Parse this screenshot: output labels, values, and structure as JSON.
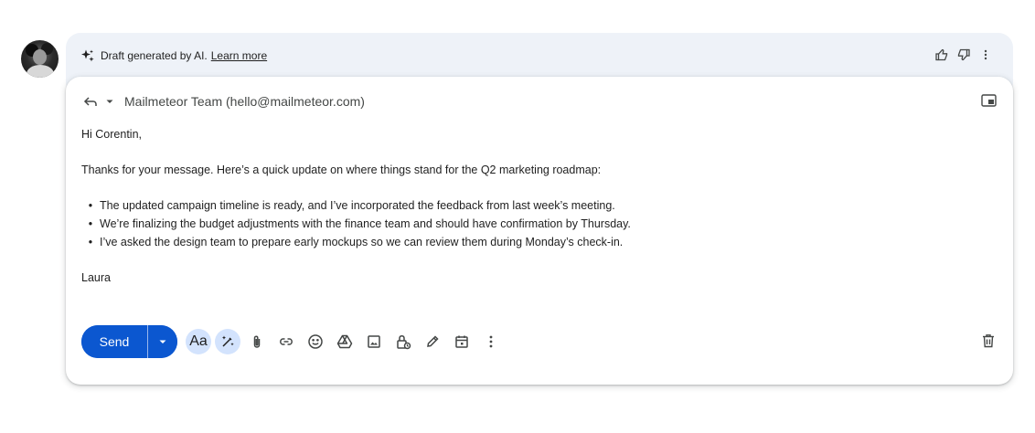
{
  "ai_banner": {
    "text": "Draft generated by AI.",
    "link": "Learn more",
    "icons": [
      "sparkle-icon",
      "thumbs-up-icon",
      "thumbs-down-icon",
      "more-vert-icon"
    ]
  },
  "compose": {
    "from": "Mailmeteor Team (hello@mailmeteor.com)",
    "greeting": "Hi Corentin,",
    "intro": "Thanks for your message. Here’s a quick update on where things stand for the Q2 marketing roadmap:",
    "bullets": [
      "The updated campaign timeline is ready, and I’ve incorporated the feedback from last week’s meeting.",
      "We’re finalizing the budget adjustments with the finance team and should have confirmation by Thursday.",
      "I’ve asked the design team to prepare early mockups so we can review them during Monday’s check-in."
    ],
    "signature": "Laura"
  },
  "toolbar": {
    "send_label": "Send",
    "format_label": "Aa",
    "icons": [
      "formatting-icon",
      "ai-pen-icon",
      "attach-icon",
      "link-icon",
      "emoji-icon",
      "drive-icon",
      "photo-icon",
      "confidential-icon",
      "signature-icon",
      "schedule-icon",
      "more-options-icon"
    ]
  },
  "colors": {
    "send": "#0b57d0",
    "banner": "#eef2f8",
    "highlight": "#d3e3fd"
  }
}
